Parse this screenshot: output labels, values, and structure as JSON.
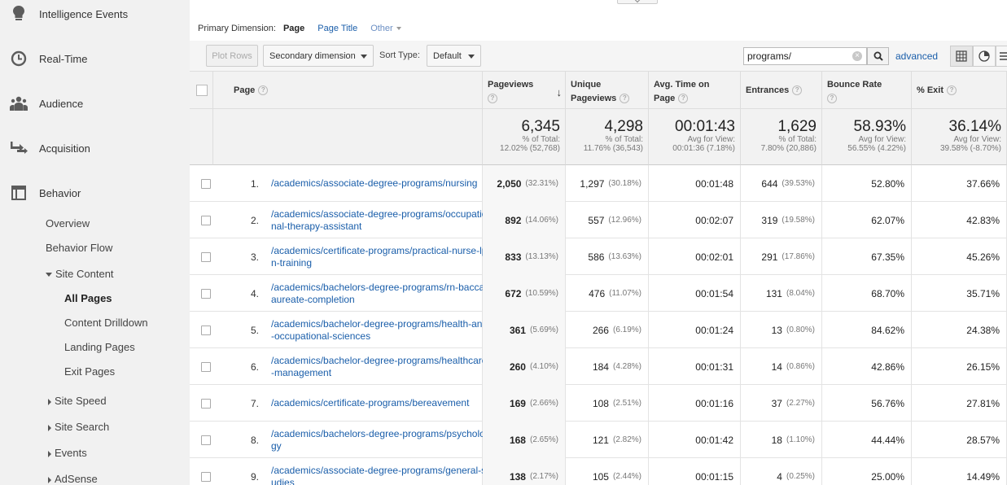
{
  "sidebar": {
    "top_items": [
      {
        "label": "Intelligence Events",
        "icon": "lightbulb-icon"
      },
      {
        "label": "Real-Time",
        "icon": "clock-icon"
      },
      {
        "label": "Audience",
        "icon": "people-icon"
      },
      {
        "label": "Acquisition",
        "icon": "acquisition-arrows-icon"
      },
      {
        "label": "Behavior",
        "icon": "behavior-window-icon"
      }
    ],
    "behavior_items": {
      "overview": "Overview",
      "behavior_flow": "Behavior Flow",
      "site_content": "Site Content",
      "all_pages": "All Pages",
      "content_drilldown": "Content Drilldown",
      "landing_pages": "Landing Pages",
      "exit_pages": "Exit Pages",
      "site_speed": "Site Speed",
      "site_search": "Site Search",
      "events": "Events",
      "adsense": "AdSense"
    }
  },
  "dimension": {
    "label": "Primary Dimension:",
    "active": "Page",
    "page_title": "Page Title",
    "other": "Other"
  },
  "toolbar": {
    "plot_rows": "Plot Rows",
    "secondary_dimension": "Secondary dimension",
    "sort_type_label": "Sort Type:",
    "sort_type_value": "Default",
    "search_value": "programs/",
    "advanced": "advanced"
  },
  "table": {
    "headers": {
      "page": "Page",
      "pageviews": "Pageviews",
      "unique_pageviews_1": "Unique",
      "unique_pageviews_2": "Pageviews",
      "avg_time_1": "Avg. Time on",
      "avg_time_2": "Page",
      "entrances": "Entrances",
      "bounce_rate": "Bounce Rate",
      "exit": "% Exit"
    },
    "totals": {
      "pageviews": {
        "value": "6,345",
        "l1": "% of Total:",
        "l2": "12.02% (52,768)"
      },
      "unique": {
        "value": "4,298",
        "l1": "% of Total:",
        "l2": "11.76% (36,543)"
      },
      "avg_time": {
        "value": "00:01:43",
        "l1": "Avg for View:",
        "l2": "00:01:36 (7.18%)"
      },
      "entrances": {
        "value": "1,629",
        "l1": "% of Total:",
        "l2": "7.80% (20,886)"
      },
      "bounce": {
        "value": "58.93%",
        "l1": "Avg for View:",
        "l2": "56.55% (4.22%)"
      },
      "exit": {
        "value": "36.14%",
        "l1": "Avg for View:",
        "l2": "39.58% (-8.70%)"
      }
    },
    "rows": [
      {
        "idx": "1.",
        "page": "/academics/associate-degree-programs/nursing",
        "pv": "2,050",
        "pv_pct": "(32.31%)",
        "upv": "1,297",
        "upv_pct": "(30.18%)",
        "time": "00:01:48",
        "ent": "644",
        "ent_pct": "(39.53%)",
        "bounce": "52.80%",
        "exit": "37.66%"
      },
      {
        "idx": "2.",
        "page": "/academics/associate-degree-programs/occupational-therapy-assistant",
        "pv": "892",
        "pv_pct": "(14.06%)",
        "upv": "557",
        "upv_pct": "(12.96%)",
        "time": "00:02:07",
        "ent": "319",
        "ent_pct": "(19.58%)",
        "bounce": "62.07%",
        "exit": "42.83%"
      },
      {
        "idx": "3.",
        "page": "/academics/certificate-programs/practical-nurse-lpn-training",
        "pv": "833",
        "pv_pct": "(13.13%)",
        "upv": "586",
        "upv_pct": "(13.63%)",
        "time": "00:02:01",
        "ent": "291",
        "ent_pct": "(17.86%)",
        "bounce": "67.35%",
        "exit": "45.26%"
      },
      {
        "idx": "4.",
        "page": "/academics/bachelors-degree-programs/rn-baccalaureate-completion",
        "pv": "672",
        "pv_pct": "(10.59%)",
        "upv": "476",
        "upv_pct": "(11.07%)",
        "time": "00:01:54",
        "ent": "131",
        "ent_pct": "(8.04%)",
        "bounce": "68.70%",
        "exit": "35.71%"
      },
      {
        "idx": "5.",
        "page": "/academics/bachelor-degree-programs/health-and-occupational-sciences",
        "pv": "361",
        "pv_pct": "(5.69%)",
        "upv": "266",
        "upv_pct": "(6.19%)",
        "time": "00:01:24",
        "ent": "13",
        "ent_pct": "(0.80%)",
        "bounce": "84.62%",
        "exit": "24.38%"
      },
      {
        "idx": "6.",
        "page": "/academics/bachelor-degree-programs/healthcare-management",
        "pv": "260",
        "pv_pct": "(4.10%)",
        "upv": "184",
        "upv_pct": "(4.28%)",
        "time": "00:01:31",
        "ent": "14",
        "ent_pct": "(0.86%)",
        "bounce": "42.86%",
        "exit": "26.15%"
      },
      {
        "idx": "7.",
        "page": "/academics/certificate-programs/bereavement",
        "pv": "169",
        "pv_pct": "(2.66%)",
        "upv": "108",
        "upv_pct": "(2.51%)",
        "time": "00:01:16",
        "ent": "37",
        "ent_pct": "(2.27%)",
        "bounce": "56.76%",
        "exit": "27.81%"
      },
      {
        "idx": "8.",
        "page": "/academics/bachelors-degree-programs/psychology",
        "pv": "168",
        "pv_pct": "(2.65%)",
        "upv": "121",
        "upv_pct": "(2.82%)",
        "time": "00:01:42",
        "ent": "18",
        "ent_pct": "(1.10%)",
        "bounce": "44.44%",
        "exit": "28.57%"
      },
      {
        "idx": "9.",
        "page": "/academics/associate-degree-programs/general-studies",
        "pv": "138",
        "pv_pct": "(2.17%)",
        "upv": "105",
        "upv_pct": "(2.44%)",
        "time": "00:01:15",
        "ent": "4",
        "ent_pct": "(0.25%)",
        "bounce": "25.00%",
        "exit": "14.49%"
      }
    ]
  },
  "colors": {
    "link": "#1a5eaa",
    "sidebar_bg": "#f1f1f1",
    "header_bg": "#f2f2f2"
  }
}
